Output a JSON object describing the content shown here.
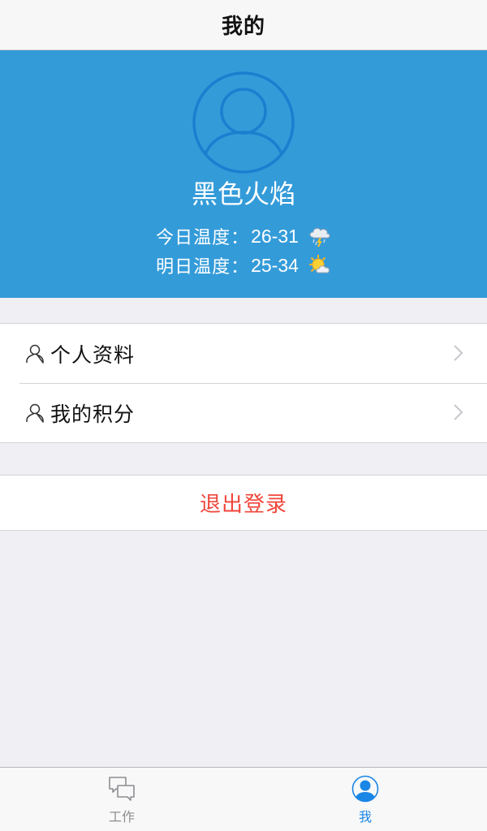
{
  "navbar": {
    "title": "我的"
  },
  "profile": {
    "username": "黑色火焰",
    "today": {
      "label": "今日温度：",
      "value": "26-31",
      "icon": "thunderstorm-rain-icon"
    },
    "tomorrow": {
      "label": "明日温度：",
      "value": "25-34",
      "icon": "sun-cloud-icon"
    }
  },
  "menu": {
    "items": [
      {
        "label": "个人资料",
        "icon": "person-outline-icon"
      },
      {
        "label": "我的积分",
        "icon": "person-outline-icon"
      }
    ]
  },
  "logout": {
    "label": "退出登录"
  },
  "tabbar": {
    "tabs": [
      {
        "label": "工作",
        "icon": "chat-bubbles-icon",
        "active": false
      },
      {
        "label": "我",
        "icon": "user-circle-icon",
        "active": true
      }
    ]
  },
  "colors": {
    "header_blue": "#349bd9",
    "logout_red": "#f0453a",
    "active_tab_blue": "#1a86e6",
    "background": "#efeff4"
  }
}
